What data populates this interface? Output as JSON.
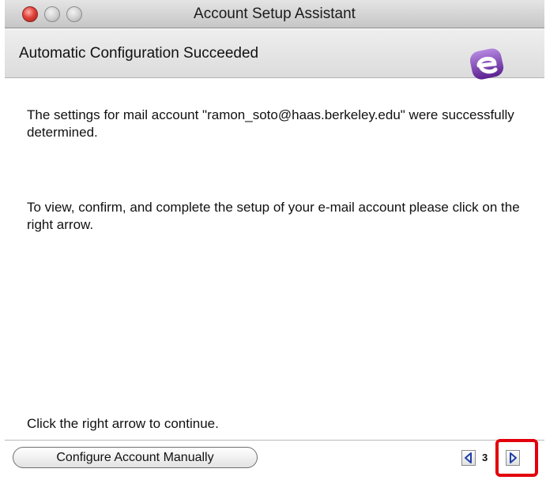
{
  "window": {
    "title": "Account Setup Assistant"
  },
  "header": {
    "title": "Automatic Configuration Succeeded"
  },
  "body": {
    "message1": "The settings for mail account \"ramon_soto@haas.berkeley.edu\" were successfully determined.",
    "message2": "To view, confirm, and complete the setup of your e-mail account please click on the right arrow.",
    "message3": "Click the right arrow to continue."
  },
  "footer": {
    "manual_button": "Configure Account Manually",
    "page_number": "3"
  },
  "icons": [
    "close-icon",
    "minimize-icon",
    "zoom-icon",
    "entourage-logo-icon",
    "left-arrow-icon",
    "right-arrow-icon"
  ],
  "colors": {
    "highlight": "#e2000c",
    "logo": "#7b3fb0",
    "close": "#e0433a"
  }
}
